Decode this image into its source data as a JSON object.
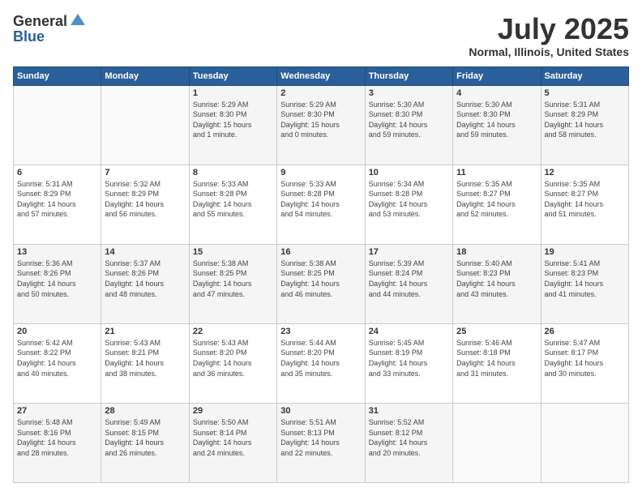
{
  "header": {
    "logo_general": "General",
    "logo_blue": "Blue",
    "title": "July 2025",
    "location": "Normal, Illinois, United States"
  },
  "days_of_week": [
    "Sunday",
    "Monday",
    "Tuesday",
    "Wednesday",
    "Thursday",
    "Friday",
    "Saturday"
  ],
  "weeks": [
    [
      {
        "day": "",
        "info": ""
      },
      {
        "day": "",
        "info": ""
      },
      {
        "day": "1",
        "info": "Sunrise: 5:29 AM\nSunset: 8:30 PM\nDaylight: 15 hours\nand 1 minute."
      },
      {
        "day": "2",
        "info": "Sunrise: 5:29 AM\nSunset: 8:30 PM\nDaylight: 15 hours\nand 0 minutes."
      },
      {
        "day": "3",
        "info": "Sunrise: 5:30 AM\nSunset: 8:30 PM\nDaylight: 14 hours\nand 59 minutes."
      },
      {
        "day": "4",
        "info": "Sunrise: 5:30 AM\nSunset: 8:30 PM\nDaylight: 14 hours\nand 59 minutes."
      },
      {
        "day": "5",
        "info": "Sunrise: 5:31 AM\nSunset: 8:29 PM\nDaylight: 14 hours\nand 58 minutes."
      }
    ],
    [
      {
        "day": "6",
        "info": "Sunrise: 5:31 AM\nSunset: 8:29 PM\nDaylight: 14 hours\nand 57 minutes."
      },
      {
        "day": "7",
        "info": "Sunrise: 5:32 AM\nSunset: 8:29 PM\nDaylight: 14 hours\nand 56 minutes."
      },
      {
        "day": "8",
        "info": "Sunrise: 5:33 AM\nSunset: 8:28 PM\nDaylight: 14 hours\nand 55 minutes."
      },
      {
        "day": "9",
        "info": "Sunrise: 5:33 AM\nSunset: 8:28 PM\nDaylight: 14 hours\nand 54 minutes."
      },
      {
        "day": "10",
        "info": "Sunrise: 5:34 AM\nSunset: 8:28 PM\nDaylight: 14 hours\nand 53 minutes."
      },
      {
        "day": "11",
        "info": "Sunrise: 5:35 AM\nSunset: 8:27 PM\nDaylight: 14 hours\nand 52 minutes."
      },
      {
        "day": "12",
        "info": "Sunrise: 5:35 AM\nSunset: 8:27 PM\nDaylight: 14 hours\nand 51 minutes."
      }
    ],
    [
      {
        "day": "13",
        "info": "Sunrise: 5:36 AM\nSunset: 8:26 PM\nDaylight: 14 hours\nand 50 minutes."
      },
      {
        "day": "14",
        "info": "Sunrise: 5:37 AM\nSunset: 8:26 PM\nDaylight: 14 hours\nand 48 minutes."
      },
      {
        "day": "15",
        "info": "Sunrise: 5:38 AM\nSunset: 8:25 PM\nDaylight: 14 hours\nand 47 minutes."
      },
      {
        "day": "16",
        "info": "Sunrise: 5:38 AM\nSunset: 8:25 PM\nDaylight: 14 hours\nand 46 minutes."
      },
      {
        "day": "17",
        "info": "Sunrise: 5:39 AM\nSunset: 8:24 PM\nDaylight: 14 hours\nand 44 minutes."
      },
      {
        "day": "18",
        "info": "Sunrise: 5:40 AM\nSunset: 8:23 PM\nDaylight: 14 hours\nand 43 minutes."
      },
      {
        "day": "19",
        "info": "Sunrise: 5:41 AM\nSunset: 8:23 PM\nDaylight: 14 hours\nand 41 minutes."
      }
    ],
    [
      {
        "day": "20",
        "info": "Sunrise: 5:42 AM\nSunset: 8:22 PM\nDaylight: 14 hours\nand 40 minutes."
      },
      {
        "day": "21",
        "info": "Sunrise: 5:43 AM\nSunset: 8:21 PM\nDaylight: 14 hours\nand 38 minutes."
      },
      {
        "day": "22",
        "info": "Sunrise: 5:43 AM\nSunset: 8:20 PM\nDaylight: 14 hours\nand 36 minutes."
      },
      {
        "day": "23",
        "info": "Sunrise: 5:44 AM\nSunset: 8:20 PM\nDaylight: 14 hours\nand 35 minutes."
      },
      {
        "day": "24",
        "info": "Sunrise: 5:45 AM\nSunset: 8:19 PM\nDaylight: 14 hours\nand 33 minutes."
      },
      {
        "day": "25",
        "info": "Sunrise: 5:46 AM\nSunset: 8:18 PM\nDaylight: 14 hours\nand 31 minutes."
      },
      {
        "day": "26",
        "info": "Sunrise: 5:47 AM\nSunset: 8:17 PM\nDaylight: 14 hours\nand 30 minutes."
      }
    ],
    [
      {
        "day": "27",
        "info": "Sunrise: 5:48 AM\nSunset: 8:16 PM\nDaylight: 14 hours\nand 28 minutes."
      },
      {
        "day": "28",
        "info": "Sunrise: 5:49 AM\nSunset: 8:15 PM\nDaylight: 14 hours\nand 26 minutes."
      },
      {
        "day": "29",
        "info": "Sunrise: 5:50 AM\nSunset: 8:14 PM\nDaylight: 14 hours\nand 24 minutes."
      },
      {
        "day": "30",
        "info": "Sunrise: 5:51 AM\nSunset: 8:13 PM\nDaylight: 14 hours\nand 22 minutes."
      },
      {
        "day": "31",
        "info": "Sunrise: 5:52 AM\nSunset: 8:12 PM\nDaylight: 14 hours\nand 20 minutes."
      },
      {
        "day": "",
        "info": ""
      },
      {
        "day": "",
        "info": ""
      }
    ]
  ]
}
